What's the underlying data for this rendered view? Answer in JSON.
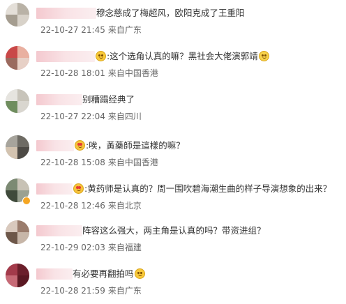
{
  "comments": [
    {
      "text": "穆念慈成了梅超风，欧阳克成了王重阳",
      "time": "22-10-27 21:45",
      "source": "来自广东"
    },
    {
      "text": ":这个选角认真的嘛？黑社会大佬演郭靖",
      "time": "22-10-28 18:01",
      "source": "来自中国香港",
      "emoji_before": "smile-emoji-icon",
      "emoji_after": "laughing-tears-emoji-icon"
    },
    {
      "text": "别糟蹋经典了",
      "time": "22-10-27 22:04",
      "source": "来自四川"
    },
    {
      "text": ":唉，黃藥師是這樣的嘛？",
      "time": "22-10-28 15:08",
      "source": "来自中国香港",
      "emoji_before": "heart-eyes-emoji-icon"
    },
    {
      "text": ":黄药师是认真的？周一围吹碧海潮生曲的样子导演想象的出来？",
      "time": "22-10-28 12:46",
      "source": "来自北京",
      "emoji_before": "heart-eyes-emoji-icon",
      "verified_badge": "verified-badge-icon"
    },
    {
      "text": "阵容这么强大，两主角是认真的吗？带资进组？",
      "time": "22-10-29 02:03",
      "source": "来自福建"
    },
    {
      "text": "有必要再翻拍吗",
      "time": "22-10-28 21:59",
      "source": "来自广东",
      "emoji_after": "smile-emoji-icon"
    }
  ]
}
